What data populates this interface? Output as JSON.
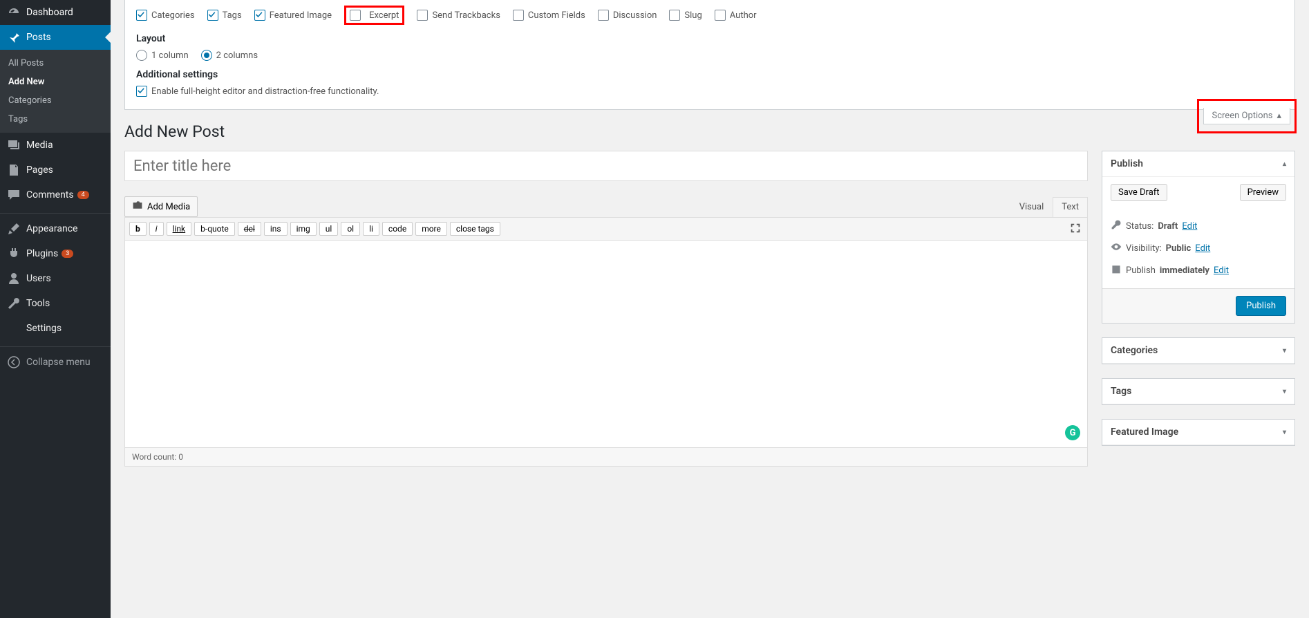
{
  "sidebar": {
    "dashboard": "Dashboard",
    "posts": "Posts",
    "posts_sub": {
      "all": "All Posts",
      "add": "Add New",
      "categories": "Categories",
      "tags": "Tags"
    },
    "media": "Media",
    "pages": "Pages",
    "comments": "Comments",
    "comments_count": "4",
    "appearance": "Appearance",
    "plugins": "Plugins",
    "plugins_count": "3",
    "users": "Users",
    "tools": "Tools",
    "settings": "Settings",
    "collapse": "Collapse menu"
  },
  "screen_options": {
    "boxes": {
      "categories": "Categories",
      "tags": "Tags",
      "featured": "Featured Image",
      "excerpt": "Excerpt",
      "trackbacks": "Send Trackbacks",
      "custom": "Custom Fields",
      "discussion": "Discussion",
      "slug": "Slug",
      "author": "Author"
    },
    "layout_label": "Layout",
    "col1": "1 column",
    "col2": "2 columns",
    "additional_label": "Additional settings",
    "fullheight": "Enable full-height editor and distraction-free functionality.",
    "tab_label": "Screen Options"
  },
  "page_title": "Add New Post",
  "title_placeholder": "Enter title here",
  "editor": {
    "add_media": "Add Media",
    "tab_visual": "Visual",
    "tab_text": "Text",
    "buttons": {
      "b": "b",
      "i": "i",
      "link": "link",
      "bquote": "b-quote",
      "del": "del",
      "ins": "ins",
      "img": "img",
      "ul": "ul",
      "ol": "ol",
      "li": "li",
      "code": "code",
      "more": "more",
      "close": "close tags"
    },
    "wordcount_label": "Word count: ",
    "wordcount": "0"
  },
  "publish": {
    "title": "Publish",
    "save_draft": "Save Draft",
    "preview": "Preview",
    "status_label": "Status: ",
    "status_value": "Draft",
    "visibility_label": "Visibility: ",
    "visibility_value": "Public",
    "publish_label": "Publish ",
    "publish_value": "immediately",
    "edit": "Edit",
    "publish_btn": "Publish"
  },
  "side_boxes": {
    "categories": "Categories",
    "tags": "Tags",
    "featured": "Featured Image"
  }
}
